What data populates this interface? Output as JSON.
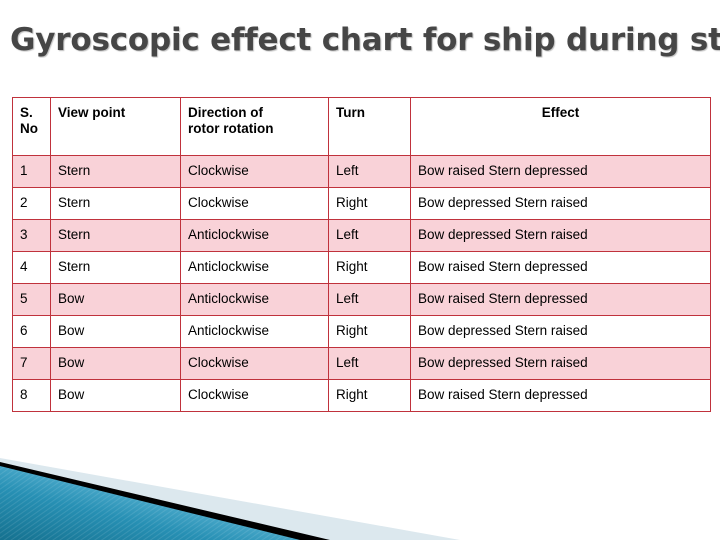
{
  "slide": {
    "title": "Gyroscopic effect chart for ship during steering",
    "title_visible": "Gyroscopic effect chart for ship during steerin"
  },
  "colors": {
    "title_text": "#464646",
    "table_border": "#c0323c",
    "row_stripe": "#f9d2d8",
    "row_plain": "#ffffff",
    "decor_teal_dark": "#1a7fa0",
    "decor_teal_light": "#5ab4d4",
    "decor_black": "#000000",
    "decor_pale": "#dce8ee"
  },
  "table": {
    "headers": {
      "sno": "S. No",
      "sno_line1": "S.",
      "sno_line2": "No",
      "view_point": "View point",
      "direction_line1": "Direction of",
      "direction_line2": "rotor rotation",
      "turn": "Turn",
      "effect": "Effect"
    },
    "rows": [
      {
        "sno": "1",
        "view_point": "Stern",
        "direction": "Clockwise",
        "turn": "Left",
        "effect": "Bow raised Stern depressed"
      },
      {
        "sno": "2",
        "view_point": "Stern",
        "direction": "Clockwise",
        "turn": "Right",
        "effect": "Bow depressed Stern raised"
      },
      {
        "sno": "3",
        "view_point": "Stern",
        "direction": "Anticlockwise",
        "turn": "Left",
        "effect": "Bow depressed Stern raised"
      },
      {
        "sno": "4",
        "view_point": "Stern",
        "direction": "Anticlockwise",
        "turn": "Right",
        "effect": "Bow raised Stern depressed"
      },
      {
        "sno": "5",
        "view_point": "Bow",
        "direction": "Anticlockwise",
        "turn": "Left",
        "effect": "Bow raised Stern depressed"
      },
      {
        "sno": "6",
        "view_point": "Bow",
        "direction": "Anticlockwise",
        "turn": "Right",
        "effect": "Bow depressed Stern raised"
      },
      {
        "sno": "7",
        "view_point": "Bow",
        "direction": "Clockwise",
        "turn": "Left",
        "effect": "Bow depressed Stern raised"
      },
      {
        "sno": "8",
        "view_point": "Bow",
        "direction": "Clockwise",
        "turn": "Right",
        "effect": "Bow raised Stern depressed"
      }
    ]
  }
}
